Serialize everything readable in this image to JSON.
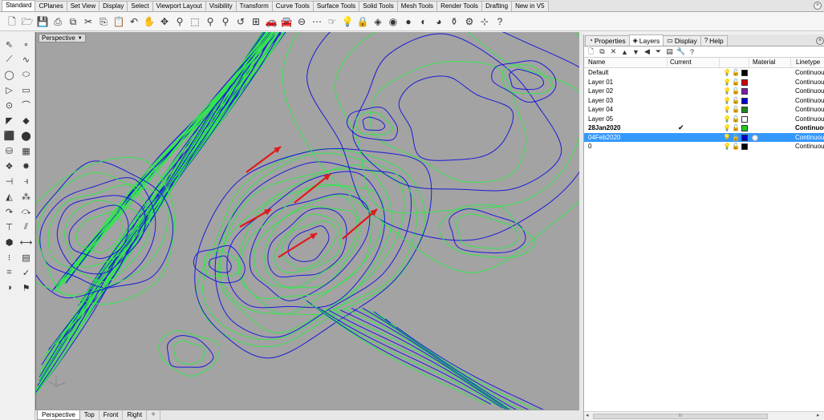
{
  "top_tabs": [
    "Standard",
    "CPlanes",
    "Set View",
    "Display",
    "Select",
    "Viewport Layout",
    "Visibility",
    "Transform",
    "Curve Tools",
    "Surface Tools",
    "Solid Tools",
    "Mesh Tools",
    "Render Tools",
    "Drafting",
    "New in V5"
  ],
  "toolbar_icons": [
    {
      "name": "new-file-icon",
      "glyph": "🗋"
    },
    {
      "name": "open-file-icon",
      "glyph": "🗁"
    },
    {
      "name": "save-icon",
      "glyph": "💾"
    },
    {
      "name": "print-icon",
      "glyph": "⎙"
    },
    {
      "name": "import-icon",
      "glyph": "⧉"
    },
    {
      "name": "cut-icon",
      "glyph": "✂"
    },
    {
      "name": "copy-icon",
      "glyph": "⎘"
    },
    {
      "name": "paste-icon",
      "glyph": "📋"
    },
    {
      "name": "undo-icon",
      "glyph": "↶"
    },
    {
      "name": "pan-hand-icon",
      "glyph": "✋"
    },
    {
      "name": "rotate-view-icon",
      "glyph": "✥"
    },
    {
      "name": "zoom-icon",
      "glyph": "⚲"
    },
    {
      "name": "zoom-window-icon",
      "glyph": "⬚"
    },
    {
      "name": "zoom-extents-icon",
      "glyph": "⚲"
    },
    {
      "name": "zoom-selected-icon",
      "glyph": "⚲"
    },
    {
      "name": "undo-view-icon",
      "glyph": "↺"
    },
    {
      "name": "four-viewports-icon",
      "glyph": "⊞"
    },
    {
      "name": "named-views-icon",
      "glyph": "🚗"
    },
    {
      "name": "named-cplanes-icon",
      "glyph": "🚘"
    },
    {
      "name": "cplane-icon",
      "glyph": "⊖"
    },
    {
      "name": "snap-icon",
      "glyph": "⋯"
    },
    {
      "name": "select-icon",
      "glyph": "☞"
    },
    {
      "name": "light-bulb-icon",
      "glyph": "💡"
    },
    {
      "name": "lock-icon",
      "glyph": "🔒"
    },
    {
      "name": "layer-icon",
      "glyph": "◈"
    },
    {
      "name": "color-wheel-icon",
      "glyph": "◉"
    },
    {
      "name": "shaded-sphere-icon",
      "glyph": "●"
    },
    {
      "name": "rendered-sphere-icon",
      "glyph": "◐"
    },
    {
      "name": "render-icon",
      "glyph": "◕"
    },
    {
      "name": "teapot-icon",
      "glyph": "⚱"
    },
    {
      "name": "gear-icon",
      "glyph": "⚙"
    },
    {
      "name": "grid-snap-icon",
      "glyph": "⊹"
    },
    {
      "name": "help-icon",
      "glyph": "?"
    }
  ],
  "side_tools": [
    {
      "name": "select-arrow-icon",
      "glyph": "⇖"
    },
    {
      "name": "point-icon",
      "glyph": "∘"
    },
    {
      "name": "polyline-icon",
      "glyph": "⟋"
    },
    {
      "name": "curve-icon",
      "glyph": "∿"
    },
    {
      "name": "circle-icon",
      "glyph": "◯"
    },
    {
      "name": "ellipse-icon",
      "glyph": "⬭"
    },
    {
      "name": "arc-icon",
      "glyph": "▷"
    },
    {
      "name": "rectangle-icon",
      "glyph": "▭"
    },
    {
      "name": "polygon-icon",
      "glyph": "⊙"
    },
    {
      "name": "fillet-icon",
      "glyph": "⌒"
    },
    {
      "name": "surface-corner-icon",
      "glyph": "◤"
    },
    {
      "name": "surface-patch-icon",
      "glyph": "◆"
    },
    {
      "name": "box-icon",
      "glyph": "⬛"
    },
    {
      "name": "sphere-icon",
      "glyph": "⬤"
    },
    {
      "name": "cylinder-icon",
      "glyph": "⛁"
    },
    {
      "name": "mesh-icon",
      "glyph": "▦"
    },
    {
      "name": "boolean-icon",
      "glyph": "❖"
    },
    {
      "name": "explode-icon",
      "glyph": "✸"
    },
    {
      "name": "trim-icon",
      "glyph": "⊣"
    },
    {
      "name": "split-icon",
      "glyph": "⫣"
    },
    {
      "name": "join-icon",
      "glyph": "◭"
    },
    {
      "name": "group-icon",
      "glyph": "⁂"
    },
    {
      "name": "move-icon",
      "glyph": "↷"
    },
    {
      "name": "copy-object-icon",
      "glyph": "⤼"
    },
    {
      "name": "scale-icon",
      "glyph": "⊤"
    },
    {
      "name": "mirror-icon",
      "glyph": "⫽"
    },
    {
      "name": "array-icon",
      "glyph": "⬢"
    },
    {
      "name": "dimension-icon",
      "glyph": "⟷"
    },
    {
      "name": "text-icon",
      "glyph": "⁝"
    },
    {
      "name": "hatch-icon",
      "glyph": "▤"
    },
    {
      "name": "analyze-icon",
      "glyph": "⌗"
    },
    {
      "name": "check-icon",
      "glyph": "✓"
    },
    {
      "name": "render-view-icon",
      "glyph": "◑"
    },
    {
      "name": "material-icon",
      "glyph": "⚑"
    }
  ],
  "viewport": {
    "label": "Perspective",
    "tabs": [
      "Perspective",
      "Top",
      "Front",
      "Right"
    ],
    "add_tab": "+",
    "colors": {
      "background": "#a3a3a3",
      "green": "#33e64d",
      "blue": "#1a1ad9",
      "arrow": "#e01a1a"
    }
  },
  "panel": {
    "tabs": [
      {
        "label": "Properties",
        "icon": "properties-icon",
        "glyph": "◔"
      },
      {
        "label": "Layers",
        "icon": "layers-icon",
        "glyph": "◈"
      },
      {
        "label": "Display",
        "icon": "display-icon",
        "glyph": "▭"
      },
      {
        "label": "Help",
        "icon": "help-icon",
        "glyph": "?"
      }
    ],
    "tools": [
      {
        "name": "new-layer-icon",
        "glyph": "🗋"
      },
      {
        "name": "new-sublayer-icon",
        "glyph": "⧉"
      },
      {
        "name": "delete-layer-icon",
        "glyph": "✕"
      },
      {
        "name": "move-up-icon",
        "glyph": "▲"
      },
      {
        "name": "move-down-icon",
        "glyph": "▼"
      },
      {
        "name": "move-parent-icon",
        "glyph": "◀"
      },
      {
        "name": "filter-icon",
        "glyph": "⏷"
      },
      {
        "name": "layer-states-icon",
        "glyph": "▤"
      },
      {
        "name": "tools-icon",
        "glyph": "🔧"
      },
      {
        "name": "help-icon",
        "glyph": "?"
      }
    ],
    "columns": {
      "name": "Name",
      "current": "Current",
      "material": "Material",
      "linetype": "Linetype"
    },
    "layers": [
      {
        "name": "Default",
        "color": "#000000",
        "current": false,
        "selected": false,
        "linetype": "Continuous"
      },
      {
        "name": "Layer 01",
        "color": "#cc0000",
        "current": false,
        "selected": false,
        "linetype": "Continuous"
      },
      {
        "name": "Layer 02",
        "color": "#7a1fa2",
        "current": false,
        "selected": false,
        "linetype": "Continuous"
      },
      {
        "name": "Layer 03",
        "color": "#0000cc",
        "current": false,
        "selected": false,
        "linetype": "Continuous"
      },
      {
        "name": "Layer 04",
        "color": "#1e8a1e",
        "current": false,
        "selected": false,
        "linetype": "Continuous"
      },
      {
        "name": "Layer 05",
        "color": "#ffffff",
        "current": false,
        "selected": false,
        "linetype": "Continuous"
      },
      {
        "name": "28Jan2020",
        "color": "#22cc22",
        "current": true,
        "selected": false,
        "linetype": "Continuous"
      },
      {
        "name": "04Feb2020",
        "color": "#0000cc",
        "current": false,
        "selected": true,
        "linetype": "Continuous"
      },
      {
        "name": "0",
        "color": "#000000",
        "current": false,
        "selected": false,
        "linetype": "Continuous"
      }
    ],
    "current_mark": "✔",
    "scroll_thumb": "III"
  }
}
